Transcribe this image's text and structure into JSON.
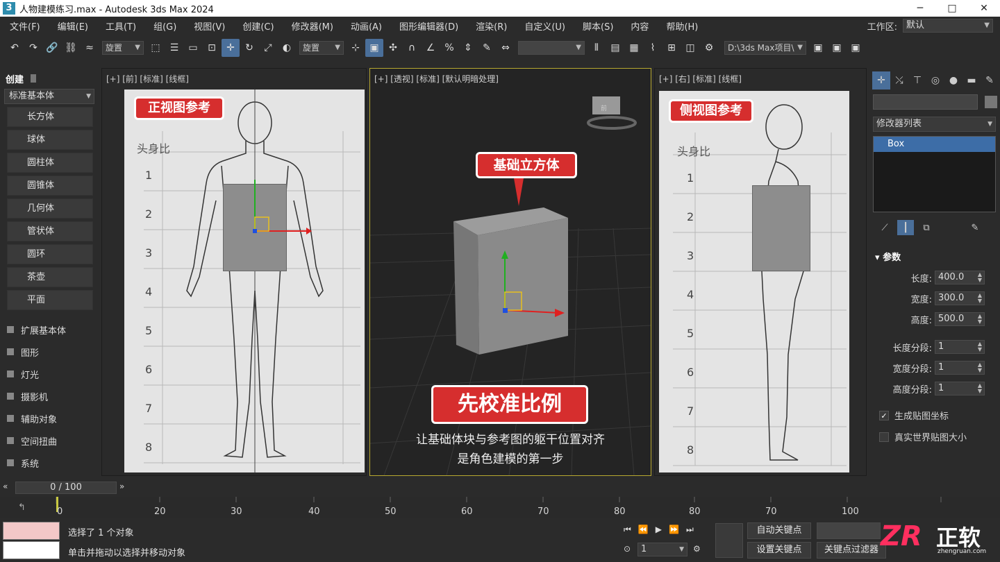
{
  "app": {
    "title": "人物建模练习.max - Autodesk 3ds Max 2024",
    "logo": "3"
  },
  "window_controls": [
    "─",
    "□",
    "✕"
  ],
  "menus": [
    "文件(F)",
    "编辑(E)",
    "工具(T)",
    "组(G)",
    "视图(V)",
    "创建(C)",
    "修改器(M)",
    "动画(A)",
    "图形编辑器(D)",
    "渲染(R)",
    "自定义(U)",
    "脚本(S)",
    "内容",
    "帮助(H)"
  ],
  "workspace": {
    "label": "工作区:",
    "value": "默认"
  },
  "toolbar": {
    "selection_set": "旋置",
    "ref_coord": "旋置",
    "path": "D:\\3ds Max项目\\"
  },
  "create_panel": {
    "header": "创建",
    "dropdown": "标准基本体",
    "buttons": [
      "长方体",
      "球体",
      "圆柱体",
      "圆锥体",
      "几何体",
      "管状体",
      "圆环",
      "茶壶",
      "平面"
    ],
    "categories": [
      "扩展基本体",
      "图形",
      "灯光",
      "摄影机",
      "辅助对象",
      "空间扭曲",
      "系统"
    ]
  },
  "viewports": {
    "front": {
      "label": "[+] [前] [标准] [线框]",
      "tag": "正视图参考",
      "ratio_label": "头身比",
      "rows": [
        "1",
        "2",
        "3",
        "4",
        "5",
        "6",
        "7",
        "8"
      ]
    },
    "perspective": {
      "label": "[+] [透视] [标准] [默认明暗处理]",
      "tag": "基础立方体",
      "headline": "先校准比例",
      "caption_line1": "让基础体块与参考图的躯干位置对齐",
      "caption_line2": "是角色建模的第一步",
      "viewcube_face": "前"
    },
    "side": {
      "label": "[+] [右] [标准] [线框]",
      "tag": "侧视图参考",
      "ratio_label": "头身比",
      "rows": [
        "1",
        "2",
        "3",
        "4",
        "5",
        "6",
        "7",
        "8"
      ]
    }
  },
  "modify_panel": {
    "modifier_list": "修改器列表",
    "stack_item": "Box",
    "rollout": "参数",
    "params": [
      {
        "label": "长度:",
        "value": "400.0"
      },
      {
        "label": "宽度:",
        "value": "300.0"
      },
      {
        "label": "高度:",
        "value": "500.0"
      }
    ],
    "segments": [
      {
        "label": "长度分段:",
        "value": "1"
      },
      {
        "label": "宽度分段:",
        "value": "1"
      },
      {
        "label": "高度分段:",
        "value": "1"
      }
    ],
    "checkboxes": [
      {
        "label": "生成贴图坐标",
        "checked": true
      },
      {
        "label": "真实世界贴图大小",
        "checked": false
      }
    ]
  },
  "timeline": {
    "slider": "0 / 100",
    "ticks": [
      "0",
      "20",
      "30",
      "40",
      "50",
      "60",
      "70",
      "80",
      "80",
      "70",
      "100"
    ]
  },
  "status": {
    "line1": "选择了 1 个对象",
    "line2": "单击并拖动以选择并移动对象",
    "frame": "1"
  },
  "keys": {
    "auto": "自动关键点",
    "set": "设置关键点",
    "filter": "关键点过滤器"
  },
  "watermark": {
    "logo": "ZR",
    "brand": "正软",
    "url": "zhengruan.com"
  }
}
